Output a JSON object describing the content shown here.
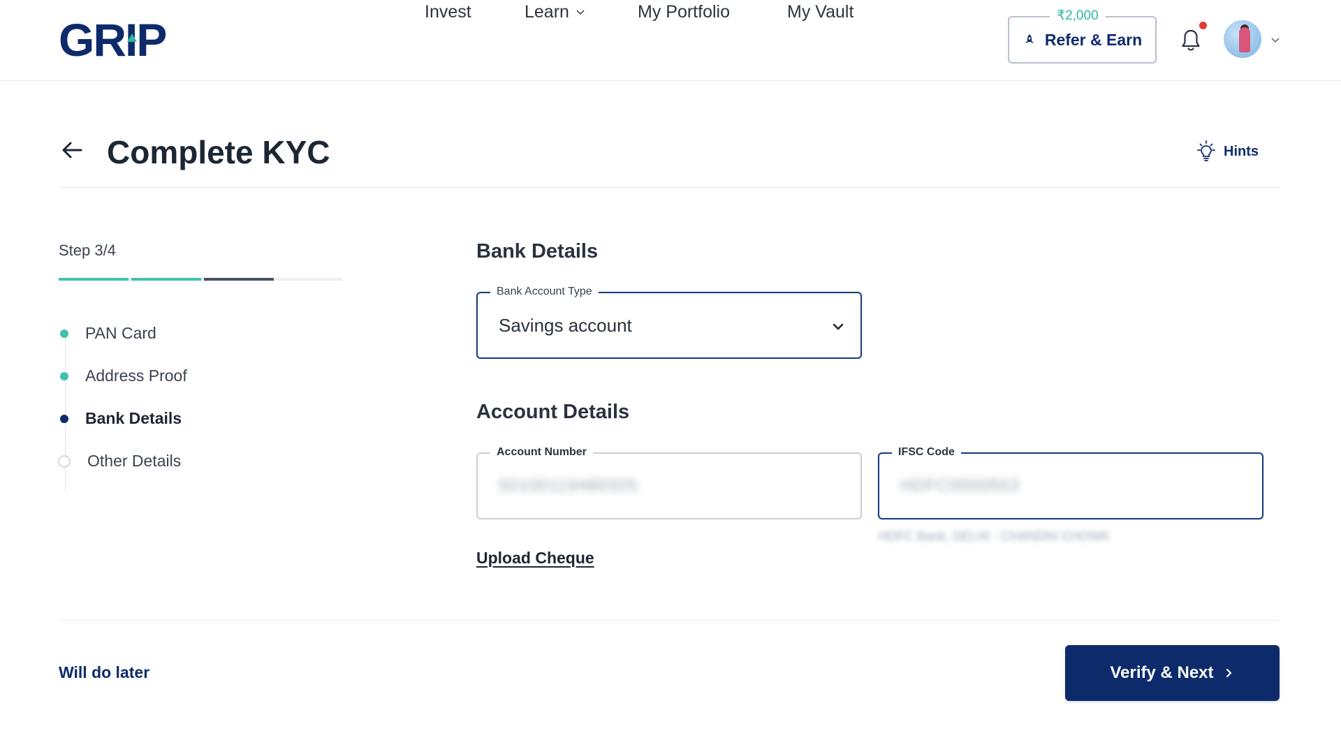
{
  "colors": {
    "brand_navy": "#0d2b6b",
    "brand_teal": "#2cb9a6",
    "progress_done": "#42c1b0",
    "progress_current": "#4b4f63",
    "notification": "#e53935"
  },
  "header": {
    "logo_text": "GRIP",
    "nav": [
      {
        "label": "Invest"
      },
      {
        "label": "Learn",
        "has_dropdown": true
      },
      {
        "label": "My Portfolio"
      },
      {
        "label": "My Vault"
      }
    ],
    "refer": {
      "label": "Refer & Earn",
      "badge": "₹2,000",
      "icon": "rocket-icon"
    },
    "notification_icon": "bell-icon",
    "avatar_icon": "user-avatar"
  },
  "page": {
    "title": "Complete KYC",
    "hints_label": "Hints",
    "hints_icon": "lightbulb-icon"
  },
  "stepper": {
    "step_text": "Step 3/4",
    "current_step": 3,
    "total_steps": 4,
    "steps": [
      {
        "label": "PAN Card",
        "status": "done"
      },
      {
        "label": "Address Proof",
        "status": "done"
      },
      {
        "label": "Bank Details",
        "status": "current"
      },
      {
        "label": "Other Details",
        "status": "pending"
      }
    ]
  },
  "form": {
    "bank_section_title": "Bank Details",
    "account_type": {
      "label": "Bank Account Type",
      "value": "Savings account"
    },
    "account_section_title": "Account Details",
    "account_number": {
      "label": "Account Number",
      "value": "50100119480325"
    },
    "ifsc": {
      "label": "IFSC Code",
      "value": "HDFC0000553"
    },
    "bank_branch_hint": "HDFC Bank, DELHI - CHANDNI CHOWK",
    "upload_cheque_label": "Upload Cheque"
  },
  "footer": {
    "later_label": "Will do later",
    "verify_label": "Verify & Next"
  }
}
